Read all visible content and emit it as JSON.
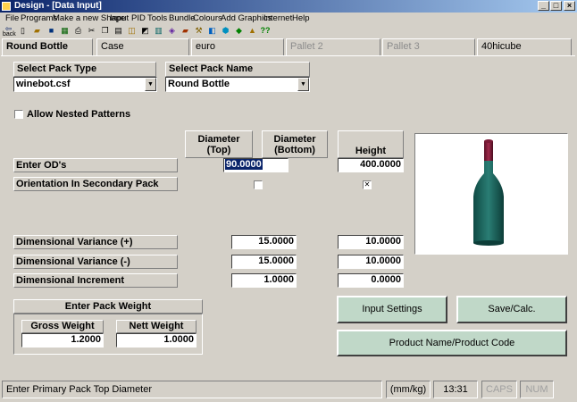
{
  "window": {
    "title": "Design - [Data Input]"
  },
  "menu": [
    "File",
    "Programs",
    "Make a new Shape",
    "Input",
    "PID",
    "Tools",
    "Bundle",
    "Colours",
    "Add Graphics",
    "Internet",
    "Help"
  ],
  "toolbar": {
    "back_label": "back",
    "help_label": "??"
  },
  "tabs": [
    "Round Bottle",
    "Case",
    "euro",
    "Pallet 2",
    "Pallet 3",
    "40hicube"
  ],
  "pack": {
    "type_label": "Select Pack Type",
    "type_value": "winebot.csf",
    "name_label": "Select Pack Name",
    "name_value": "Round Bottle",
    "nested_label": "Allow Nested Patterns"
  },
  "columns": {
    "diam_top": "Diameter\n(Top)",
    "diam_bottom": "Diameter\n(Bottom)",
    "height": "Height"
  },
  "rows": {
    "ods_label": "Enter OD's",
    "ods_top": "90.0000",
    "ods_height": "400.0000",
    "orient_label": "Orientation In Secondary Pack",
    "orient_top_checked": false,
    "orient_height_checked": true,
    "var_plus_label": "Dimensional Variance (+)",
    "var_plus_top": "15.0000",
    "var_plus_height": "10.0000",
    "var_minus_label": "Dimensional Variance (-)",
    "var_minus_top": "15.0000",
    "var_minus_height": "10.0000",
    "incr_label": "Dimensional Increment",
    "incr_top": "1.0000",
    "incr_height": "0.0000"
  },
  "weight": {
    "title": "Enter Pack Weight",
    "gross_label": "Gross Weight",
    "gross_value": "1.2000",
    "nett_label": "Nett Weight",
    "nett_value": "1.0000"
  },
  "buttons": {
    "input_settings": "Input Settings",
    "save_calc": "Save/Calc.",
    "product_name": "Product Name/Product Code"
  },
  "status": {
    "message": "Enter Primary Pack Top Diameter",
    "units": "(mm/kg)",
    "time": "13:31",
    "caps": "CAPS",
    "num": "NUM"
  },
  "colors": {
    "button_bg": "#c0d8c8",
    "bottle_body": "#1f6b64",
    "bottle_neck": "#8b1a3a"
  }
}
